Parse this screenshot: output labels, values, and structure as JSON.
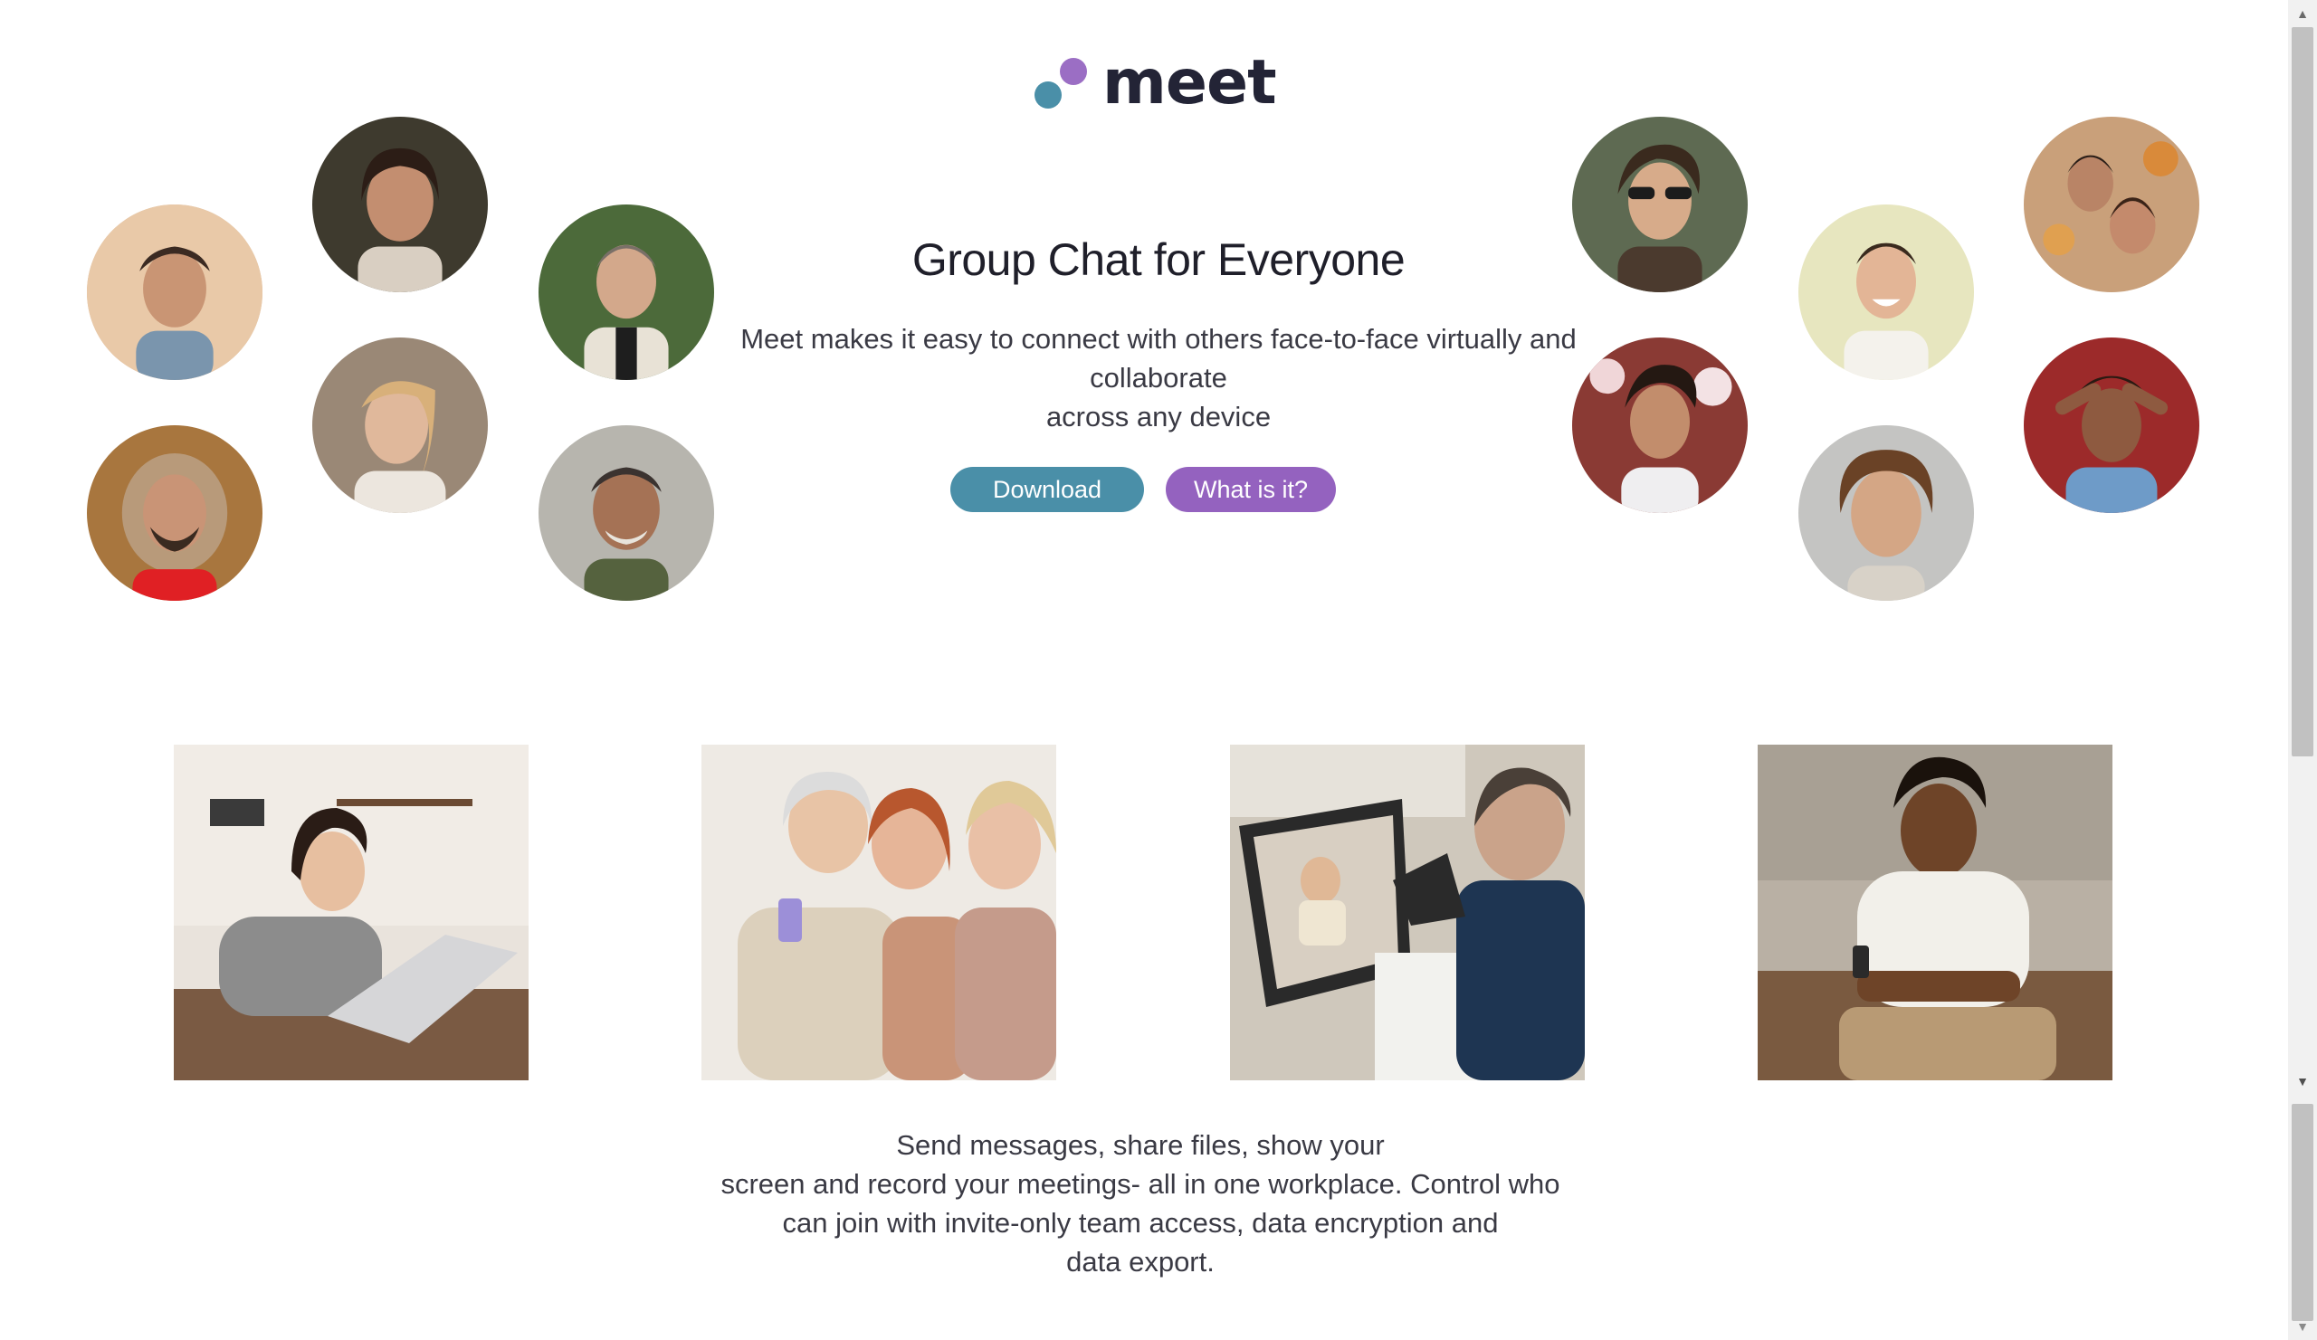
{
  "brand": {
    "name": "meet",
    "dot_teal": "#4a8fa8",
    "dot_purple": "#9b6ec4"
  },
  "hero": {
    "title": "Group Chat for Everyone",
    "description_lines": [
      "Meet makes it easy to connect with others face-to-face virtually and",
      "collaborate",
      "across any device"
    ],
    "download_label": "Download",
    "what_label": "What is it?"
  },
  "colors": {
    "download": "#4a8fa8",
    "what": "#9462bf"
  },
  "avatars_left": [
    "person-photo",
    "person-photo",
    "person-photo",
    "person-photo",
    "person-photo",
    "person-photo"
  ],
  "avatars_right": [
    "person-photo",
    "person-photo",
    "person-photo",
    "person-photo",
    "person-photo",
    "person-photo"
  ],
  "feature_photos": [
    "laptop-video-call-photo",
    "friends-phone-photo",
    "video-meeting-photo",
    "man-phone-photo"
  ],
  "features_text_lines": [
    "Send messages, share files, show your",
    "screen and record your meetings- all in one workplace. Control who",
    "can join with invite-only team access, data encryption and",
    "data export."
  ]
}
